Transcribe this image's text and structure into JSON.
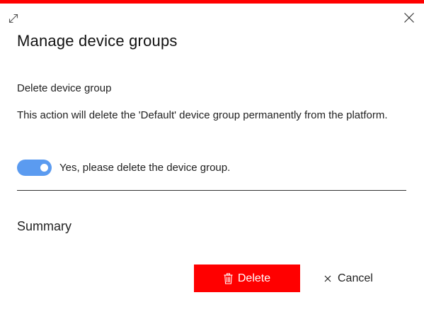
{
  "colors": {
    "accent_bar": "#ff0000",
    "delete_button": "#ff0000",
    "toggle_on": "#5b9bf0"
  },
  "icons": {
    "expand": "expand-diagonal-icon",
    "close": "close-icon",
    "delete": "trash-icon",
    "cancel": "x-icon"
  },
  "panel": {
    "title": "Manage device groups",
    "section_heading": "Delete device group",
    "warning_text": "This action will delete the 'Default' device group permanently from the platform.",
    "confirm_toggle": {
      "checked": true,
      "label": "Yes, please delete the device group."
    },
    "summary_heading": "Summary"
  },
  "actions": {
    "delete_label": "Delete",
    "cancel_label": "Cancel"
  }
}
